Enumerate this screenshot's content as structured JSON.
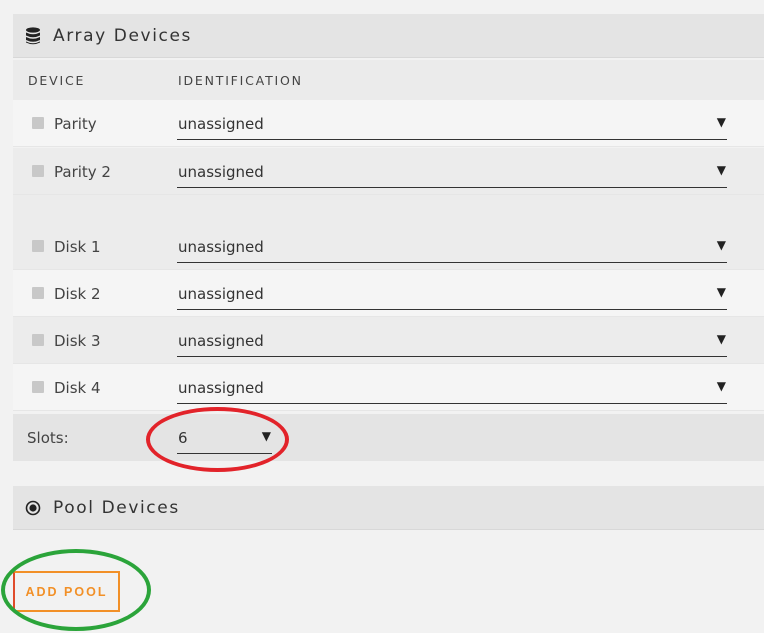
{
  "array_devices": {
    "title": "Array Devices",
    "icon": "database-icon",
    "columns": {
      "device": "DEVICE",
      "identification": "IDENTIFICATION"
    },
    "rows": [
      {
        "label": "Parity",
        "value": "unassigned"
      },
      {
        "label": "Parity 2",
        "value": "unassigned"
      },
      {
        "label": "Disk 1",
        "value": "unassigned"
      },
      {
        "label": "Disk 2",
        "value": "unassigned"
      },
      {
        "label": "Disk 3",
        "value": "unassigned"
      },
      {
        "label": "Disk 4",
        "value": "unassigned"
      }
    ],
    "slots": {
      "label": "Slots:",
      "value": "6"
    }
  },
  "pool_devices": {
    "title": "Pool Devices",
    "icon": "target-icon",
    "add_button": "ADD POOL"
  },
  "colors": {
    "red_highlight": "#e2232a",
    "green_highlight": "#2ba43a",
    "accent_orange": "#f29027"
  }
}
